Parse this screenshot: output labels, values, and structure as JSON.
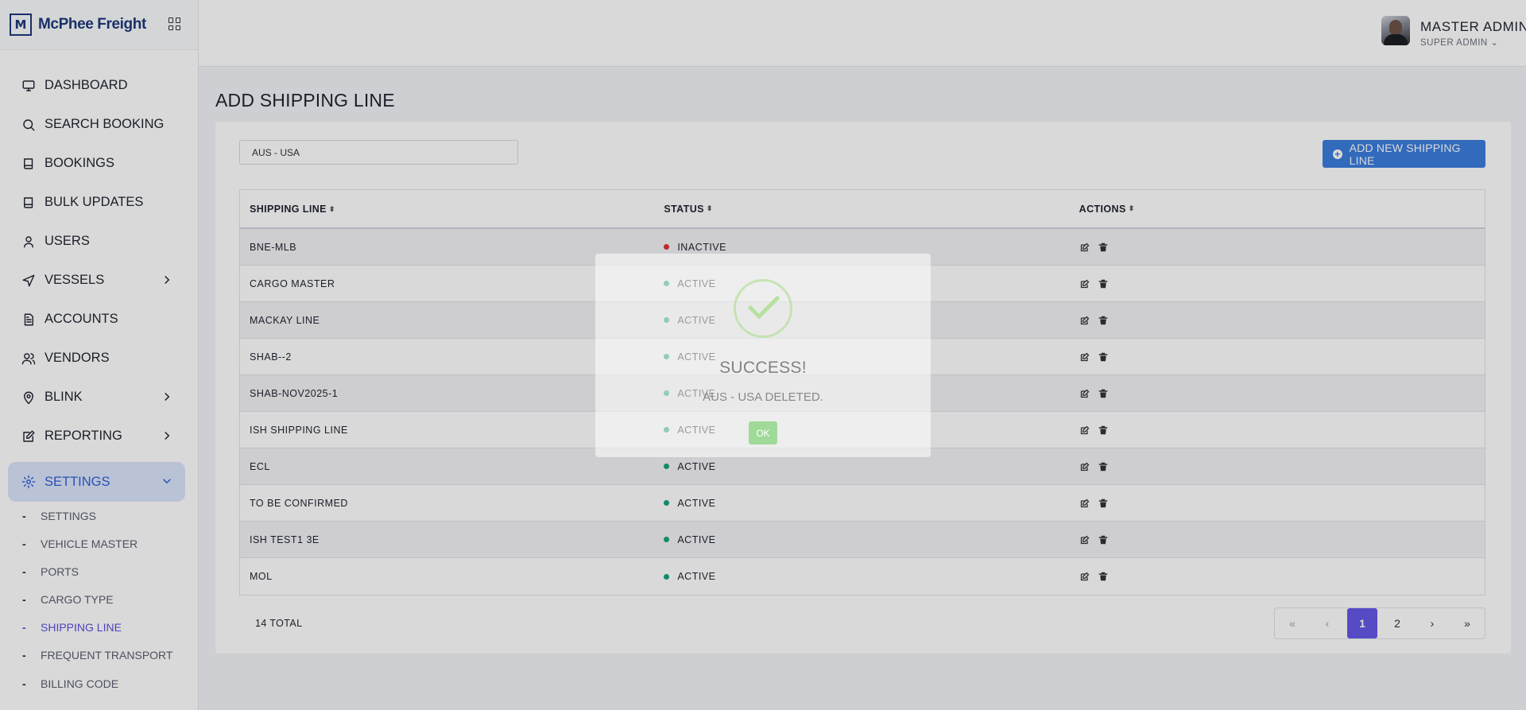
{
  "brand": {
    "name": "McPhee Freight",
    "logo_letter": "M"
  },
  "sidebar": {
    "items": [
      {
        "label": "DASHBOARD",
        "icon": "monitor-icon"
      },
      {
        "label": "SEARCH BOOKING",
        "icon": "search-icon"
      },
      {
        "label": "BOOKINGS",
        "icon": "book-icon"
      },
      {
        "label": "BULK UPDATES",
        "icon": "book-icon"
      },
      {
        "label": "USERS",
        "icon": "user-icon"
      },
      {
        "label": "VESSELS",
        "icon": "send-icon"
      },
      {
        "label": "ACCOUNTS",
        "icon": "file-icon"
      },
      {
        "label": "VENDORS",
        "icon": "users-icon"
      },
      {
        "label": "BLINK",
        "icon": "map-pin-icon"
      },
      {
        "label": "REPORTING",
        "icon": "edit-icon"
      },
      {
        "label": "SETTINGS",
        "icon": "gear-icon"
      }
    ],
    "sub_items": [
      "SETTINGS",
      "VEHICLE MASTER",
      "PORTS",
      "CARGO TYPE",
      "SHIPPING LINE",
      "FREQUENT TRANSPORT",
      "BILLING CODE"
    ],
    "active_sub": "SHIPPING LINE"
  },
  "header": {
    "user_name": "MASTER ADMIN",
    "user_role": "SUPER ADMIN ⌄"
  },
  "page": {
    "title": "ADD SHIPPING LINE",
    "search_value": "AUS - USA",
    "add_button": "ADD NEW SHIPPING LINE"
  },
  "table": {
    "headers": [
      "SHIPPING LINE",
      "STATUS",
      "ACTIONS"
    ],
    "rows": [
      {
        "name": "BNE-MLB",
        "status": "INACTIVE"
      },
      {
        "name": "CARGO MASTER",
        "status": "ACTIVE"
      },
      {
        "name": "MACKAY LINE",
        "status": "ACTIVE"
      },
      {
        "name": "SHAB--2",
        "status": "ACTIVE"
      },
      {
        "name": "SHAB-NOV2025-1",
        "status": "ACTIVE"
      },
      {
        "name": "ISH SHIPPING LINE",
        "status": "ACTIVE"
      },
      {
        "name": "ECL",
        "status": "ACTIVE"
      },
      {
        "name": "TO BE CONFIRMED",
        "status": "ACTIVE"
      },
      {
        "name": "ISH TEST1 3E",
        "status": "ACTIVE"
      },
      {
        "name": "MOL",
        "status": "ACTIVE"
      }
    ],
    "total": "14 TOTAL"
  },
  "pagination": {
    "first": "«",
    "prev": "‹",
    "pages": [
      "1",
      "2"
    ],
    "current": "1",
    "next": "›",
    "last": "»"
  },
  "colors": {
    "active": "#14a37f",
    "inactive": "#e0303a",
    "accent": "#3b7ddd",
    "pager_active": "#6757e8"
  },
  "modal": {
    "title": "SUCCESS!",
    "message": "AUS - USA DELETED.",
    "ok": "OK"
  }
}
